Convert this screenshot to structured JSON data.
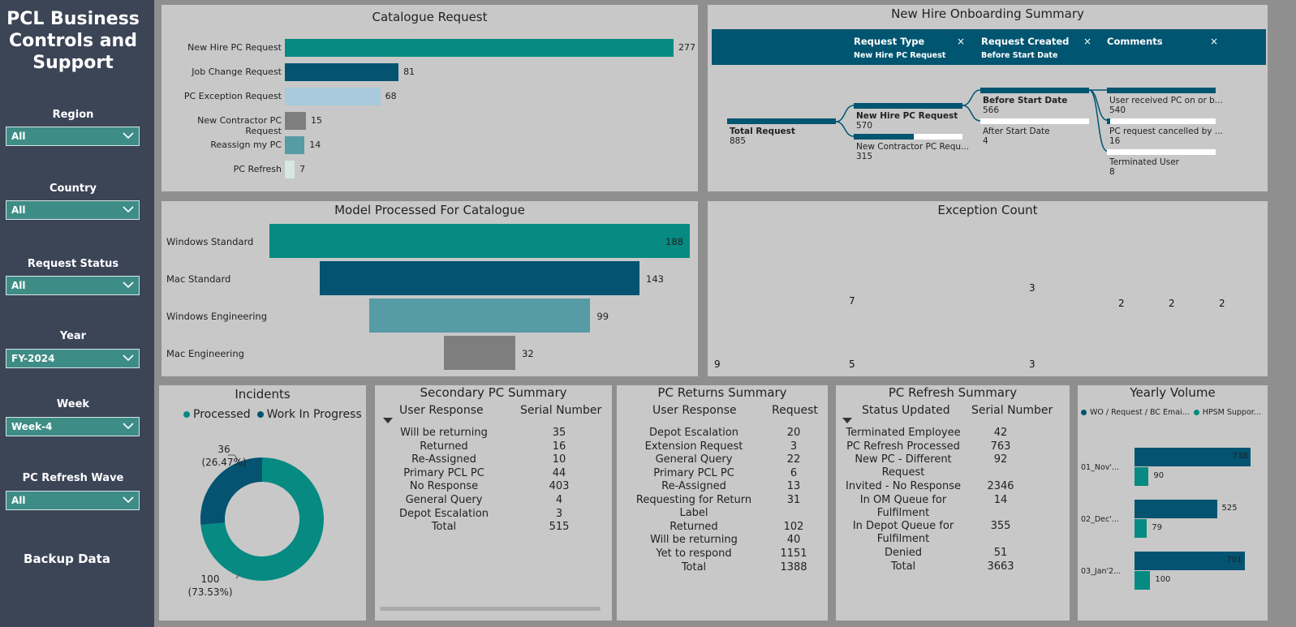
{
  "sidebar": {
    "title_lines": [
      "PCL Business",
      "Controls and",
      "Support"
    ],
    "slicers": [
      {
        "label": "Region",
        "value": "All"
      },
      {
        "label": "Country",
        "value": "All"
      },
      {
        "label": "Request Status",
        "value": "All"
      },
      {
        "label": "Year",
        "value": "FY-2024"
      },
      {
        "label": "Week",
        "value": "Week-4"
      },
      {
        "label": "PC Refresh Wave",
        "value": "All"
      }
    ],
    "backup_label": "Backup Data"
  },
  "catalogue": {
    "title": "Catalogue Request",
    "chart_data": {
      "type": "bar",
      "categories": [
        "New Hire PC Request",
        "Job Change Request",
        "PC Exception Request",
        "New Contractor PC Request",
        "Reassign my PC",
        "PC Refresh"
      ],
      "values": [
        277,
        81,
        68,
        15,
        14,
        7
      ],
      "colors": [
        "#068a82",
        "#035371",
        "#a8cadc",
        "#7e7e7e",
        "#579ba4",
        "#d8e6e4"
      ]
    }
  },
  "newhire": {
    "title": "New Hire Onboarding Summary",
    "header": [
      {
        "label": "Request Type",
        "value": "New Hire PC Request"
      },
      {
        "label": "Request Created",
        "value": "Before Start Date"
      },
      {
        "label": "Comments",
        "value": ""
      }
    ],
    "close_glyph": "×",
    "nodes": {
      "total": {
        "label": "Total Request",
        "value": "885"
      },
      "new_hire": {
        "label": "New Hire PC Request",
        "value": "570"
      },
      "contractor": {
        "label": "New Contractor PC Requ...",
        "value": "315"
      },
      "before": {
        "label": "Before Start Date",
        "value": "566"
      },
      "after": {
        "label": "After Start Date",
        "value": "4"
      },
      "received": {
        "label": "User received PC on or b...",
        "value": "540"
      },
      "cancelled": {
        "label": "PC request cancelled by ...",
        "value": "16"
      },
      "terminated": {
        "label": "Terminated User",
        "value": "8"
      }
    }
  },
  "model": {
    "title": "Model Processed For Catalogue",
    "chart_data": {
      "type": "bar",
      "categories": [
        "Windows Standard",
        "Mac Standard",
        "Windows Engineering",
        "Mac Engineering"
      ],
      "values": [
        188,
        143,
        99,
        32
      ],
      "colors": [
        "#068a82",
        "#035371",
        "#579ba4",
        "#7e7e7e"
      ]
    }
  },
  "exception": {
    "title": "Exception Count",
    "cells": [
      {
        "value": "9",
        "color": "#035371"
      },
      {
        "value": "7",
        "color": "#068a82"
      },
      {
        "value": "5",
        "color": "#5fb9a9"
      },
      {
        "value": "3",
        "color": "#c3d2ea"
      },
      {
        "value": "3",
        "color": "#7e7e7e"
      },
      {
        "value": "2",
        "color": "#9aa6b8"
      },
      {
        "value": "2",
        "color": "#d8e6e4"
      },
      {
        "value": "2",
        "color": "#51677f"
      },
      {
        "value": "",
        "color": "#3353a8"
      },
      {
        "value": "",
        "color": "#3799b6"
      },
      {
        "value": "",
        "color": "#b0c5d4"
      },
      {
        "value": "",
        "color": "#3f8cc0"
      }
    ]
  },
  "incidents": {
    "title": "Incidents",
    "legend": [
      {
        "name": "Processed",
        "color": "#068a82"
      },
      {
        "name": "Work In Progress",
        "color": "#035371"
      }
    ],
    "chart_data": {
      "type": "pie",
      "categories": [
        "Processed",
        "Work In Progress"
      ],
      "values": [
        100,
        36
      ],
      "percent_labels": [
        "(73.53%)",
        "(26.47%)"
      ]
    }
  },
  "secondary": {
    "title": "Secondary PC Summary",
    "headers": [
      "User Response",
      "Serial Number"
    ],
    "rows": [
      [
        "Will be returning",
        "35"
      ],
      [
        "Returned",
        "16"
      ],
      [
        "Re-Assigned",
        "10"
      ],
      [
        "Primary PCL PC",
        "44"
      ],
      [
        "No Response",
        "403"
      ],
      [
        "General Query",
        "4"
      ],
      [
        "Depot Escalation",
        "3"
      ],
      [
        "Total",
        "515"
      ]
    ]
  },
  "returns": {
    "title": "PC Returns Summary",
    "headers": [
      "User Response",
      "Request"
    ],
    "rows": [
      [
        "Depot Escalation",
        "20"
      ],
      [
        "Extension Request",
        "3"
      ],
      [
        "General Query",
        "22"
      ],
      [
        "Primary PCL PC",
        "6"
      ],
      [
        "Re-Assigned",
        "13"
      ],
      [
        "Requesting for Return Label",
        "31"
      ],
      [
        "Returned",
        "102"
      ],
      [
        "Will be returning",
        "40"
      ],
      [
        "Yet to respond",
        "1151"
      ],
      [
        "Total",
        "1388"
      ]
    ]
  },
  "refresh": {
    "title": "PC Refresh Summary",
    "headers": [
      "Status Updated",
      "Serial Number"
    ],
    "rows": [
      [
        "Terminated Employee",
        "42"
      ],
      [
        "PC Refresh Processed",
        "763"
      ],
      [
        "New PC - Different Request",
        "92"
      ],
      [
        "Invited - No Response",
        "2346"
      ],
      [
        "In OM Queue for Fulfilment",
        "14"
      ],
      [
        "In Depot Queue for Fulfilment",
        "355"
      ],
      [
        "Denied",
        "51"
      ],
      [
        "Total",
        "3663"
      ]
    ]
  },
  "yearly": {
    "title": "Yearly Volume",
    "legend": [
      {
        "name": "WO / Request / BC Emai...",
        "color": "#035371"
      },
      {
        "name": "HPSM Suppor...",
        "color": "#068a82"
      }
    ],
    "chart_data": {
      "type": "bar",
      "categories": [
        "01_Nov'...",
        "02_Dec'...",
        "03_Jan'2..."
      ],
      "series": [
        {
          "name": "WO / Request / BC Emai...",
          "values": [
            738,
            525,
            701
          ]
        },
        {
          "name": "HPSM Suppor...",
          "values": [
            90,
            79,
            100
          ]
        }
      ]
    }
  }
}
